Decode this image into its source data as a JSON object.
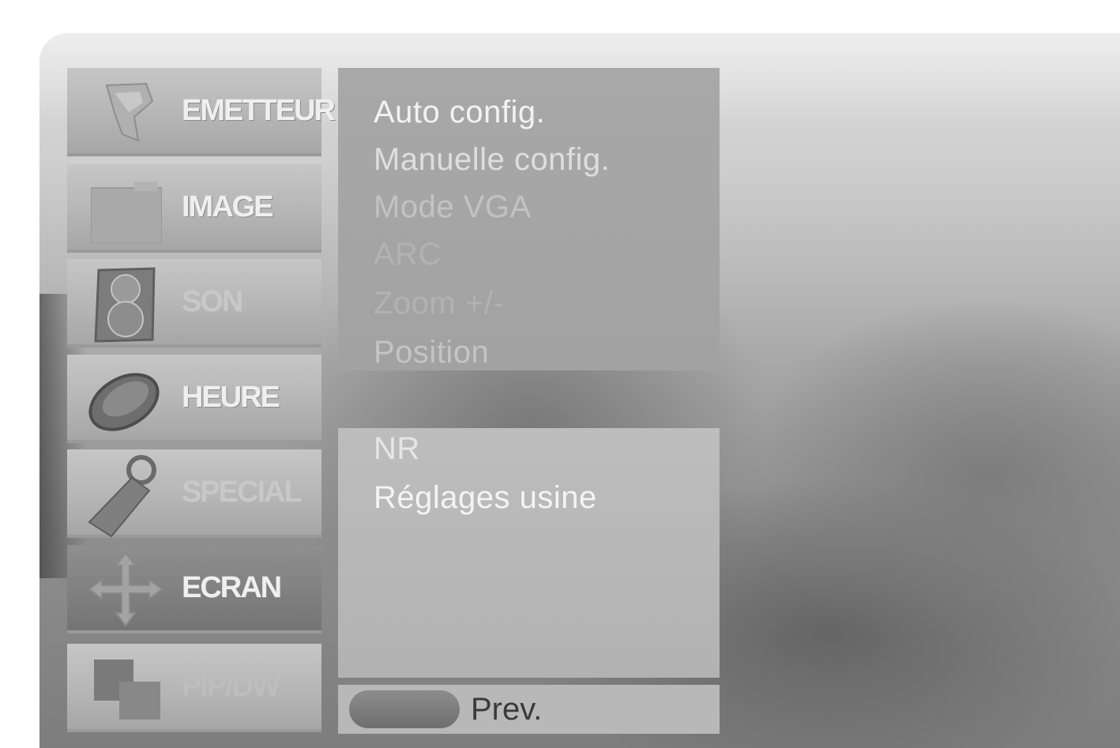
{
  "sidebar": {
    "items": [
      {
        "label": "EMETTEUR",
        "icon": "satellite-dish-icon",
        "active": false
      },
      {
        "label": "IMAGE",
        "icon": "picture-frame-icon",
        "active": false
      },
      {
        "label": "SON",
        "icon": "speaker-icon",
        "active": false
      },
      {
        "label": "HEURE",
        "icon": "clock-icon",
        "active": false
      },
      {
        "label": "SPECIAL",
        "icon": "tag-icon",
        "active": false
      },
      {
        "label": "ECRAN",
        "icon": "move-arrows-icon",
        "active": true
      },
      {
        "label": "PIP/DW",
        "icon": "pip-windows-icon",
        "active": false
      }
    ]
  },
  "screen_menu": {
    "items": [
      "Auto config.",
      "Manuelle config.",
      "Mode VGA",
      "ARC",
      "Zoom +/-",
      "Position"
    ]
  },
  "extra_menu": {
    "items": [
      "NR",
      "Réglages usine"
    ]
  },
  "footer": {
    "prev_label": "Prev."
  }
}
